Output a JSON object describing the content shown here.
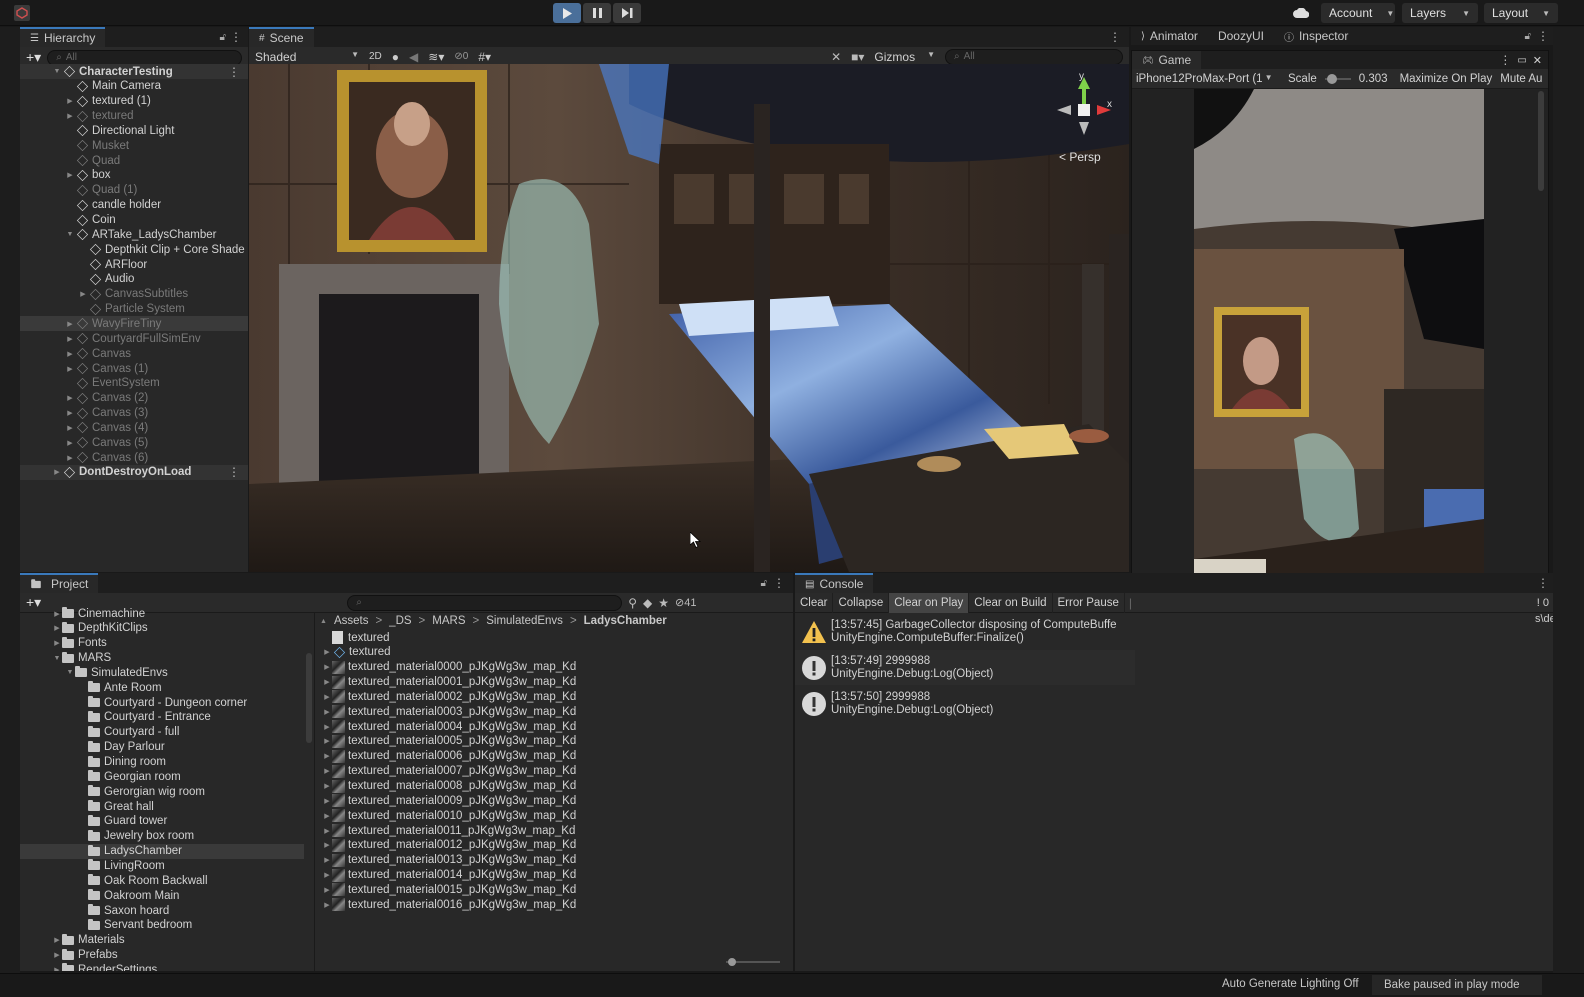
{
  "toolbar": {
    "account": "Account",
    "layers": "Layers",
    "layout": "Layout"
  },
  "hierarchy": {
    "tab": "Hierarchy",
    "search_placeholder": "All",
    "items": [
      {
        "label": "CharacterTesting",
        "indent": 0,
        "fold": "▼",
        "root": true
      },
      {
        "label": "Main Camera",
        "indent": 1
      },
      {
        "label": "textured (1)",
        "indent": 1,
        "fold": "▶"
      },
      {
        "label": "textured",
        "indent": 1,
        "fold": "▶",
        "dim": true
      },
      {
        "label": "Directional Light",
        "indent": 1
      },
      {
        "label": "Musket",
        "indent": 1,
        "dim": true
      },
      {
        "label": "Quad",
        "indent": 1,
        "dim": true
      },
      {
        "label": "box",
        "indent": 1,
        "fold": "▶"
      },
      {
        "label": "Quad (1)",
        "indent": 1,
        "dim": true
      },
      {
        "label": "candle holder",
        "indent": 1
      },
      {
        "label": "Coin",
        "indent": 1
      },
      {
        "label": "ARTake_LadysChamber",
        "indent": 1,
        "fold": "▼"
      },
      {
        "label": "Depthkit Clip + Core Shade",
        "indent": 2
      },
      {
        "label": "ARFloor",
        "indent": 2
      },
      {
        "label": "Audio",
        "indent": 2
      },
      {
        "label": "CanvasSubtitles",
        "indent": 2,
        "fold": "▶",
        "dim": true
      },
      {
        "label": "Particle System",
        "indent": 2,
        "dim": true
      },
      {
        "label": "WavyFireTiny",
        "indent": 1,
        "fold": "▶",
        "dim": true,
        "hl": true
      },
      {
        "label": "CourtyardFullSimEnv",
        "indent": 1,
        "fold": "▶",
        "dim": true
      },
      {
        "label": "Canvas",
        "indent": 1,
        "fold": "▶",
        "dim": true
      },
      {
        "label": "Canvas (1)",
        "indent": 1,
        "fold": "▶",
        "dim": true
      },
      {
        "label": "EventSystem",
        "indent": 1,
        "dim": true
      },
      {
        "label": "Canvas (2)",
        "indent": 1,
        "fold": "▶",
        "dim": true
      },
      {
        "label": "Canvas (3)",
        "indent": 1,
        "fold": "▶",
        "dim": true
      },
      {
        "label": "Canvas (4)",
        "indent": 1,
        "fold": "▶",
        "dim": true
      },
      {
        "label": "Canvas (5)",
        "indent": 1,
        "fold": "▶",
        "dim": true
      },
      {
        "label": "Canvas (6)",
        "indent": 1,
        "fold": "▶",
        "dim": true
      },
      {
        "label": "DontDestroyOnLoad",
        "indent": 0,
        "fold": "▶",
        "root": true,
        "hl": true
      }
    ]
  },
  "scene": {
    "tab": "Scene",
    "shading": "Shaded",
    "mode2d": "2D",
    "hidden_count": "0",
    "gizmos": "Gizmos",
    "search_placeholder": "All",
    "persp": "Persp",
    "axis_x": "x",
    "axis_y": "y"
  },
  "right_tabs": {
    "animator": "Animator",
    "doozy": "DoozyUI",
    "inspector": "Inspector"
  },
  "game": {
    "tab": "Game",
    "device": "iPhone12ProMax-Port (1",
    "scale_label": "Scale",
    "scale_value": "0.303",
    "maximize": "Maximize On Play",
    "mute": "Mute Au"
  },
  "project": {
    "tab": "Project",
    "hidden_count": "41",
    "breadcrumb": [
      "Assets",
      "_DS",
      "MARS",
      "SimulatedEnvs",
      "LadysChamber"
    ],
    "tree": [
      {
        "label": "Cinemachine",
        "indent": 2,
        "fold": "▶"
      },
      {
        "label": "DepthKitClips",
        "indent": 2,
        "fold": "▶"
      },
      {
        "label": "Fonts",
        "indent": 2,
        "fold": "▶"
      },
      {
        "label": "MARS",
        "indent": 2,
        "fold": "▼"
      },
      {
        "label": "SimulatedEnvs",
        "indent": 3,
        "fold": "▼"
      },
      {
        "label": "Ante Room",
        "indent": 4
      },
      {
        "label": "Courtyard - Dungeon corner",
        "indent": 4
      },
      {
        "label": "Courtyard - Entrance",
        "indent": 4
      },
      {
        "label": "Courtyard - full",
        "indent": 4
      },
      {
        "label": "Day Parlour",
        "indent": 4
      },
      {
        "label": "Dining room",
        "indent": 4
      },
      {
        "label": "Georgian room",
        "indent": 4
      },
      {
        "label": "Gerorgian wig room",
        "indent": 4
      },
      {
        "label": "Great hall",
        "indent": 4
      },
      {
        "label": "Guard tower",
        "indent": 4
      },
      {
        "label": "Jewelry box room",
        "indent": 4
      },
      {
        "label": "LadysChamber",
        "indent": 4,
        "hl": true
      },
      {
        "label": "LivingRoom",
        "indent": 4
      },
      {
        "label": "Oak Room Backwall",
        "indent": 4
      },
      {
        "label": "Oakroom Main",
        "indent": 4
      },
      {
        "label": "Saxon hoard",
        "indent": 4
      },
      {
        "label": "Servant bedroom",
        "indent": 4
      },
      {
        "label": "Materials",
        "indent": 2,
        "fold": "▶"
      },
      {
        "label": "Prefabs",
        "indent": 2,
        "fold": "▶"
      },
      {
        "label": "RenderSettings",
        "indent": 2,
        "fold": "▶"
      }
    ],
    "files": [
      {
        "label": "textured",
        "kind": "doc"
      },
      {
        "label": "textured",
        "kind": "prefab"
      },
      {
        "label": "textured_material0000_pJKgWg3w_map_Kd",
        "kind": "tex"
      },
      {
        "label": "textured_material0001_pJKgWg3w_map_Kd",
        "kind": "tex"
      },
      {
        "label": "textured_material0002_pJKgWg3w_map_Kd",
        "kind": "tex"
      },
      {
        "label": "textured_material0003_pJKgWg3w_map_Kd",
        "kind": "tex"
      },
      {
        "label": "textured_material0004_pJKgWg3w_map_Kd",
        "kind": "tex"
      },
      {
        "label": "textured_material0005_pJKgWg3w_map_Kd",
        "kind": "tex"
      },
      {
        "label": "textured_material0006_pJKgWg3w_map_Kd",
        "kind": "tex"
      },
      {
        "label": "textured_material0007_pJKgWg3w_map_Kd",
        "kind": "tex"
      },
      {
        "label": "textured_material0008_pJKgWg3w_map_Kd",
        "kind": "tex"
      },
      {
        "label": "textured_material0009_pJKgWg3w_map_Kd",
        "kind": "tex"
      },
      {
        "label": "textured_material0010_pJKgWg3w_map_Kd",
        "kind": "tex"
      },
      {
        "label": "textured_material0011_pJKgWg3w_map_Kd",
        "kind": "tex"
      },
      {
        "label": "textured_material0012_pJKgWg3w_map_Kd",
        "kind": "tex"
      },
      {
        "label": "textured_material0013_pJKgWg3w_map_Kd",
        "kind": "tex"
      },
      {
        "label": "textured_material0014_pJKgWg3w_map_Kd",
        "kind": "tex"
      },
      {
        "label": "textured_material0015_pJKgWg3w_map_Kd",
        "kind": "tex"
      },
      {
        "label": "textured_material0016_pJKgWg3w_map_Kd",
        "kind": "tex"
      }
    ]
  },
  "console": {
    "tab": "Console",
    "buttons": [
      "Clear",
      "Collapse",
      "Clear on Play",
      "Clear on Build",
      "Error Pause"
    ],
    "clear_on_play_active": true,
    "error_count": "0",
    "right_fragment": "s\\de",
    "messages": [
      {
        "level": "warning",
        "line1": "[13:57:45] GarbageCollector disposing of ComputeBuffe",
        "line2": "UnityEngine.ComputeBuffer:Finalize()"
      },
      {
        "level": "info",
        "line1": "[13:57:49] 2999988",
        "line2": "UnityEngine.Debug:Log(Object)"
      },
      {
        "level": "info",
        "line1": "[13:57:50] 2999988",
        "line2": "UnityEngine.Debug:Log(Object)"
      }
    ]
  },
  "status": {
    "lighting": "Auto Generate Lighting Off",
    "bake": "Bake paused in play mode"
  },
  "colors": {
    "accent": "#3a79bb",
    "play_active": "#4a6f9a",
    "warning": "#f2c14e"
  }
}
